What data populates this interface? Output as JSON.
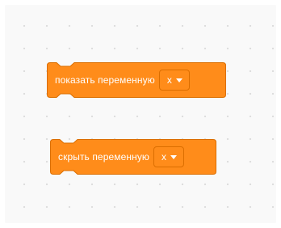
{
  "colors": {
    "block_fill": "#ff8c1a",
    "block_border": "#db6e00",
    "workspace_bg": "#f9f9f9"
  },
  "blocks": {
    "show_variable": {
      "label": "показать переменную",
      "dropdown_value": "x",
      "dropdown_icon": "chevron-down-icon"
    },
    "hide_variable": {
      "label": "скрыть переменную",
      "dropdown_value": "x",
      "dropdown_icon": "chevron-down-icon"
    }
  }
}
